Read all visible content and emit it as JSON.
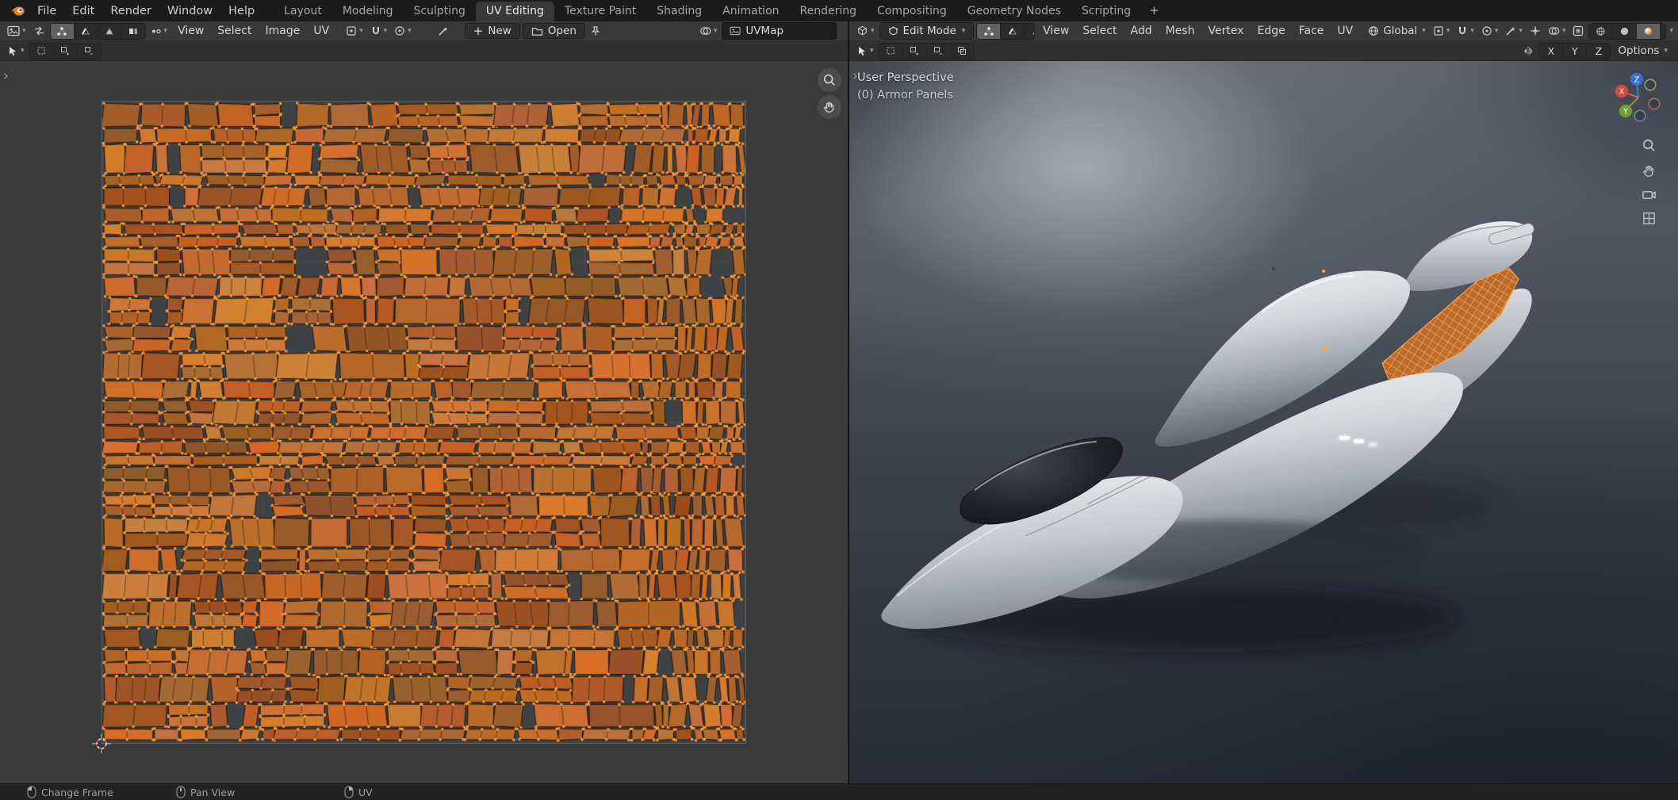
{
  "topbar": {
    "menus": [
      "File",
      "Edit",
      "Render",
      "Window",
      "Help"
    ],
    "tabs": [
      "Layout",
      "Modeling",
      "Sculpting",
      "UV Editing",
      "Texture Paint",
      "Shading",
      "Animation",
      "Rendering",
      "Compositing",
      "Geometry Nodes",
      "Scripting"
    ],
    "active_tab": "UV Editing",
    "add_tab_label": "+"
  },
  "uv_editor": {
    "menus": [
      "View",
      "Select",
      "Image",
      "UV"
    ],
    "buttons": {
      "new": "New",
      "open": "Open"
    },
    "image_field": "UVMap"
  },
  "viewport": {
    "mode_selector": "Edit Mode",
    "menus": [
      "View",
      "Select",
      "Add",
      "Mesh",
      "Vertex",
      "Edge",
      "Face",
      "UV"
    ],
    "orientation": "Global",
    "options_label": "Options",
    "axis_toggles": [
      "X",
      "Y",
      "Z"
    ],
    "gizmo_axes": [
      "X",
      "Y",
      "Z"
    ],
    "overlay": {
      "line1": "User Perspective",
      "line2": "(0) Armor Panels"
    }
  },
  "statusbar": {
    "items": [
      {
        "mouse": "left",
        "label": "Change Frame"
      },
      {
        "mouse": "middle",
        "label": "Pan View"
      },
      {
        "mouse": "right",
        "label": "UV"
      }
    ]
  },
  "colors": {
    "uv_face_fill": "#c06a28",
    "uv_vertex": "#ff9d3c",
    "selection_accent": "#e8862d",
    "header_bg": "#383838",
    "viewport_bg_top": "#565d66",
    "viewport_bg_bottom": "#272c35"
  }
}
